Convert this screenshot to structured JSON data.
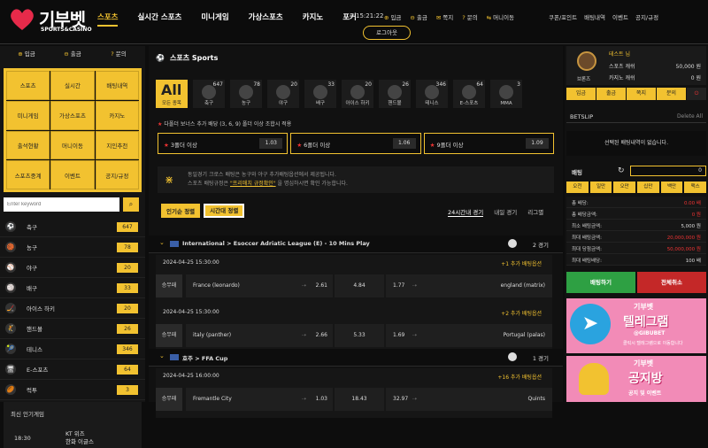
{
  "brand": {
    "logo_text": "기부벳",
    "logo_sub": "SPORTS&CASINO"
  },
  "nav": [
    "스포츠",
    "실시간 스포츠",
    "미니게임",
    "가상스포츠",
    "카지노",
    "포커"
  ],
  "header": {
    "clock": "15:21:22",
    "quick": [
      {
        "icon": "plus-icon",
        "glyph": "⊕",
        "label": "입금"
      },
      {
        "icon": "minus-icon",
        "glyph": "⊖",
        "label": "출금"
      },
      {
        "icon": "mail-icon",
        "glyph": "✉",
        "label": "쪽지"
      },
      {
        "icon": "question-icon",
        "glyph": "?",
        "label": "문의"
      },
      {
        "icon": "swap-icon",
        "glyph": "⇆",
        "label": "머니이동"
      }
    ],
    "right_links": [
      "쿠폰/포인트",
      "배팅내역",
      "이벤트",
      "공지/규정"
    ],
    "logout": "로그아웃"
  },
  "left": {
    "tabs": [
      {
        "glyph": "⊕",
        "label": "입금"
      },
      {
        "glyph": "⊖",
        "label": "출금"
      },
      {
        "glyph": "?",
        "label": "문의"
      }
    ],
    "grid": [
      "스포츠",
      "실시간",
      "배팅내역",
      "미니게임",
      "가상스포츠",
      "카지노",
      "출석현황",
      "머니이동",
      "지인추천",
      "스포츠중계",
      "이벤트",
      "공지/규정"
    ],
    "search_placeholder": "Enter keyword",
    "sports": [
      {
        "glyph": "⚽",
        "name": "축구",
        "count": "647"
      },
      {
        "glyph": "🏀",
        "name": "농구",
        "count": "78"
      },
      {
        "glyph": "⚾",
        "name": "야구",
        "count": "20"
      },
      {
        "glyph": "🏐",
        "name": "배구",
        "count": "33"
      },
      {
        "glyph": "🏒",
        "name": "아이스 하키",
        "count": "20"
      },
      {
        "glyph": "🤾",
        "name": "핸드볼",
        "count": "26"
      },
      {
        "glyph": "🎾",
        "name": "테니스",
        "count": "346"
      },
      {
        "glyph": "🖥",
        "name": "E-스포츠",
        "count": "64"
      },
      {
        "glyph": "🏉",
        "name": "럭투",
        "count": "3"
      }
    ],
    "recent_title": "최신 인기게임",
    "recent_time": "18:30",
    "recent_team1": "KT 위즈",
    "recent_team2": "한화 이글스"
  },
  "center": {
    "title": "스포츠 Sports",
    "sport_icons": [
      {
        "label": "모든 종목",
        "count": "All"
      },
      {
        "label": "축구",
        "count": "647"
      },
      {
        "label": "농구",
        "count": "78"
      },
      {
        "label": "야구",
        "count": "20"
      },
      {
        "label": "배구",
        "count": "33"
      },
      {
        "label": "아이스 하키",
        "count": "20"
      },
      {
        "label": "핸드볼",
        "count": "26"
      },
      {
        "label": "테니스",
        "count": "346"
      },
      {
        "label": "E-스포츠",
        "count": "64"
      },
      {
        "label": "MMA",
        "count": "3"
      }
    ],
    "bonus_title": "다폴더 보너스 추가 배당 (3, 6, 9) 폴더 이상 조합시 적용",
    "bonus": [
      {
        "label": "3폴더 이상",
        "value": "1.03"
      },
      {
        "label": "6폴더 이상",
        "value": "1.06"
      },
      {
        "label": "9폴더 이상",
        "value": "1.09"
      }
    ],
    "notice_line1": "동일경기 크로스 배팅은 농구와 야구 추가배팅옵션에서 제공됩니다.",
    "notice_line2_pre": "스포츠 배팅규정은",
    "notice_link": "\"프리매치 규정확인\"",
    "notice_line2_post": "을 명심하시면 확인 가능합니다.",
    "sort_buttons": [
      "인기순 정렬",
      "시간대 정렬"
    ],
    "sort_tabs": [
      "24시간내 경기",
      "내일 경기",
      "리그별"
    ],
    "leagues": [
      {
        "name": "International > Esoccer Adriatic League (E) - 10 Mins Play",
        "count": "2 경기"
      },
      {
        "name": "호주 > FFA Cup",
        "count": "1 경기"
      }
    ],
    "matches": [
      {
        "datetime": "2024-04-25 15:30:00",
        "more": "+1 추가 배팅옵션",
        "label": "승무패",
        "home": "France (leonardo)",
        "home_odds": "2.61",
        "draw": "4.84",
        "away_odds": "1.77",
        "away": "england (matrix)"
      },
      {
        "datetime": "2024-04-25 15:30:00",
        "more": "+2 추가 배팅옵션",
        "label": "승무패",
        "home": "italy (panther)",
        "home_odds": "2.66",
        "draw": "5.33",
        "away_odds": "1.69",
        "away": "Portugal (palas)"
      },
      {
        "datetime": "2024-04-25 16:00:00",
        "more": "+16 추가 배팅옵션",
        "label": "승무패",
        "home": "Fremantle City",
        "home_odds": "1.03",
        "draw": "18.43",
        "away_odds": "32.97",
        "away": "Quints"
      }
    ]
  },
  "right": {
    "username": "테스트 님",
    "sports_money_label": "스포츠 캐쉬",
    "sports_money": "50,000 원",
    "casino_money_label": "카지노 캐쉬",
    "casino_money": "0 원",
    "rank": "브론즈",
    "buttons": [
      "입금",
      "출금",
      "쪽지",
      "문의"
    ],
    "betslip_title": "BETSLIP",
    "delete_all": "Delete All",
    "empty_msg": "선택된 배팅내역이 없습니다.",
    "bet_label": "배팅",
    "bet_value": "0",
    "amount_buttons": [
      "오천",
      "일만",
      "오만",
      "십만",
      "백만",
      "맥스"
    ],
    "info": [
      {
        "k": "총 배당:",
        "v": "0.00 배",
        "red": true
      },
      {
        "k": "총 배당금액:",
        "v": "0 원",
        "red": true
      },
      {
        "k": "최소 배팅금액:",
        "v": "5,000 원",
        "red": false
      },
      {
        "k": "최대 배팅금액:",
        "v": "20,000,000 원",
        "red": true
      },
      {
        "k": "최대 당첨금액:",
        "v": "50,000,000 원",
        "red": true
      },
      {
        "k": "최대 배팅배당:",
        "v": "100 배",
        "red": false
      }
    ],
    "bet_button": "배팅하기",
    "cancel_button": "전체취소",
    "banner1": {
      "t1": "기부벳",
      "t2": "텔레그램",
      "t3": "@GIBUBET",
      "t4": "클릭시 텔레그램으로 이동합니다"
    },
    "banner2": {
      "t1": "기부벳",
      "t2": "공지방",
      "t3": "공지 및 이벤트"
    }
  },
  "colors": {
    "accent": "#f2c230",
    "background": "#0d0d0d",
    "success": "#2ea043",
    "danger": "#c42828"
  }
}
